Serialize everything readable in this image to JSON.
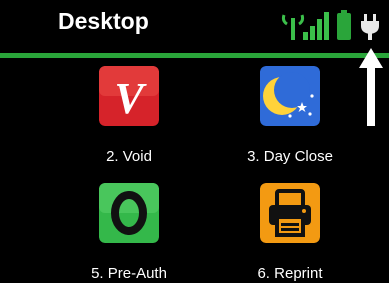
{
  "header": {
    "title": "Desktop",
    "status_icons": [
      "antenna-icon",
      "signal-bars-icon",
      "battery-icon",
      "power-plug-icon"
    ],
    "accent_color": "#2aa53a"
  },
  "apps": [
    {
      "label": "2. Void",
      "glyph": "V",
      "icon": "void-icon",
      "color": "#d6232a"
    },
    {
      "label": "3. Day Close",
      "glyph": "",
      "icon": "moon-stars-icon",
      "color": "#2f6bd8"
    },
    {
      "label": "5. Pre-Auth",
      "glyph": "O",
      "icon": "pre-auth-icon",
      "color": "#34b84a"
    },
    {
      "label": "6. Reprint",
      "glyph": "",
      "icon": "printer-icon",
      "color": "#f39a12"
    }
  ]
}
